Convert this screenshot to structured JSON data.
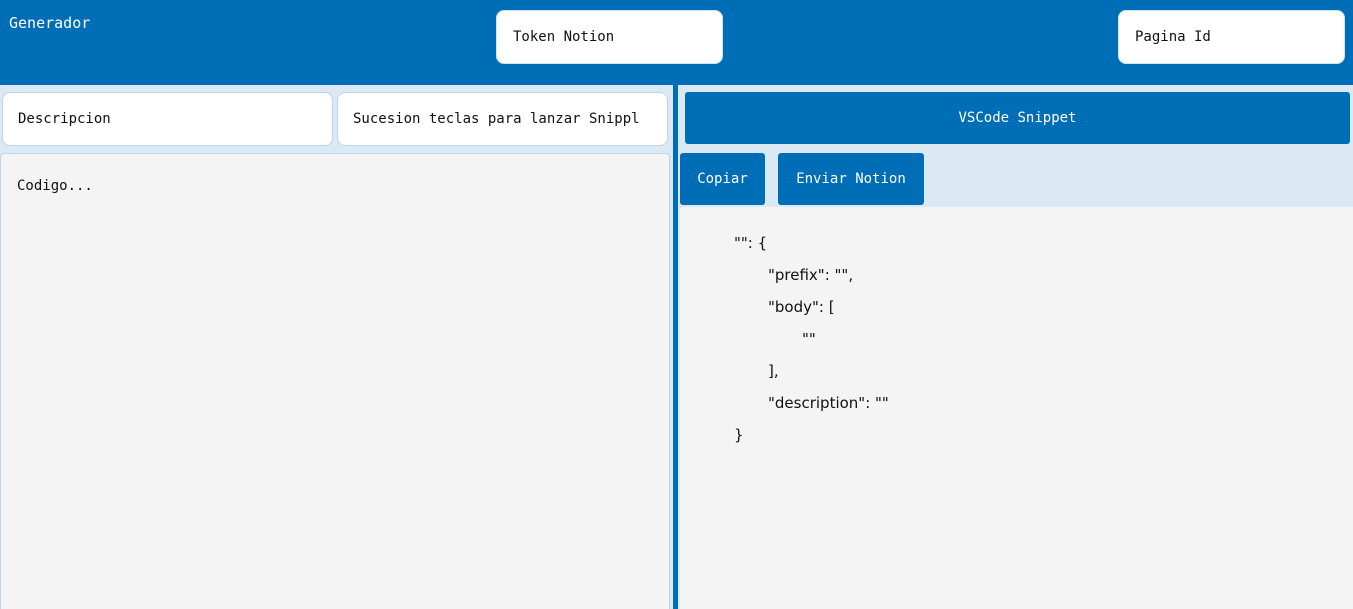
{
  "header": {
    "app_title": "Generador",
    "token_placeholder": "Token Notion",
    "page_id_placeholder": "Pagina Id"
  },
  "left": {
    "description_placeholder": "Descripcion",
    "keys_placeholder": "Sucesion teclas para lanzar Snippl",
    "code_placeholder": "Codigo..."
  },
  "right": {
    "title": "VSCode Snippet",
    "copy_label": "Copiar",
    "send_label": "Enviar Notion",
    "output_lines": [
      "\"\": {",
      "\"prefix\": \"\",",
      "\"body\": [",
      "\"\"",
      "],",
      "\"description\": \"\"",
      "}"
    ]
  },
  "colors": {
    "primary": "#006eb6",
    "panel_bg": "#dbe9f5",
    "editor_bg": "#f4f4f4"
  }
}
